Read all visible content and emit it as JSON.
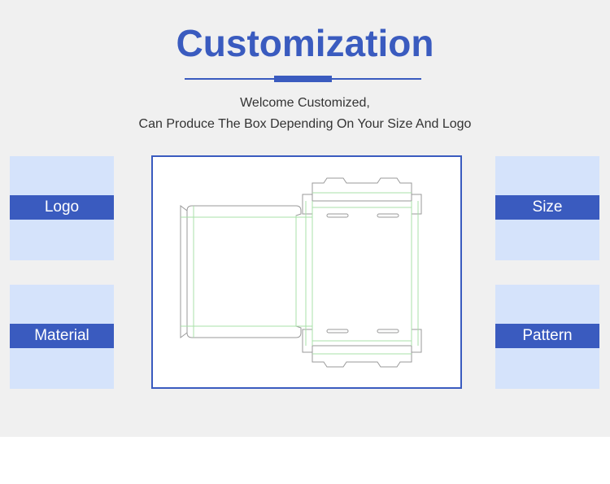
{
  "header": {
    "title": "Customization",
    "subtitle_line1": "Welcome Customized,",
    "subtitle_line2": "Can Produce The Box Depending On Your Size And Logo"
  },
  "cards": {
    "logo": "Logo",
    "material": "Material",
    "size": "Size",
    "pattern": "Pattern"
  },
  "colors": {
    "accent": "#3a5bbf",
    "card_bg": "#d5e3fb",
    "panel_bg": "#f0f0f0",
    "fold_line": "#a8e0a8"
  }
}
